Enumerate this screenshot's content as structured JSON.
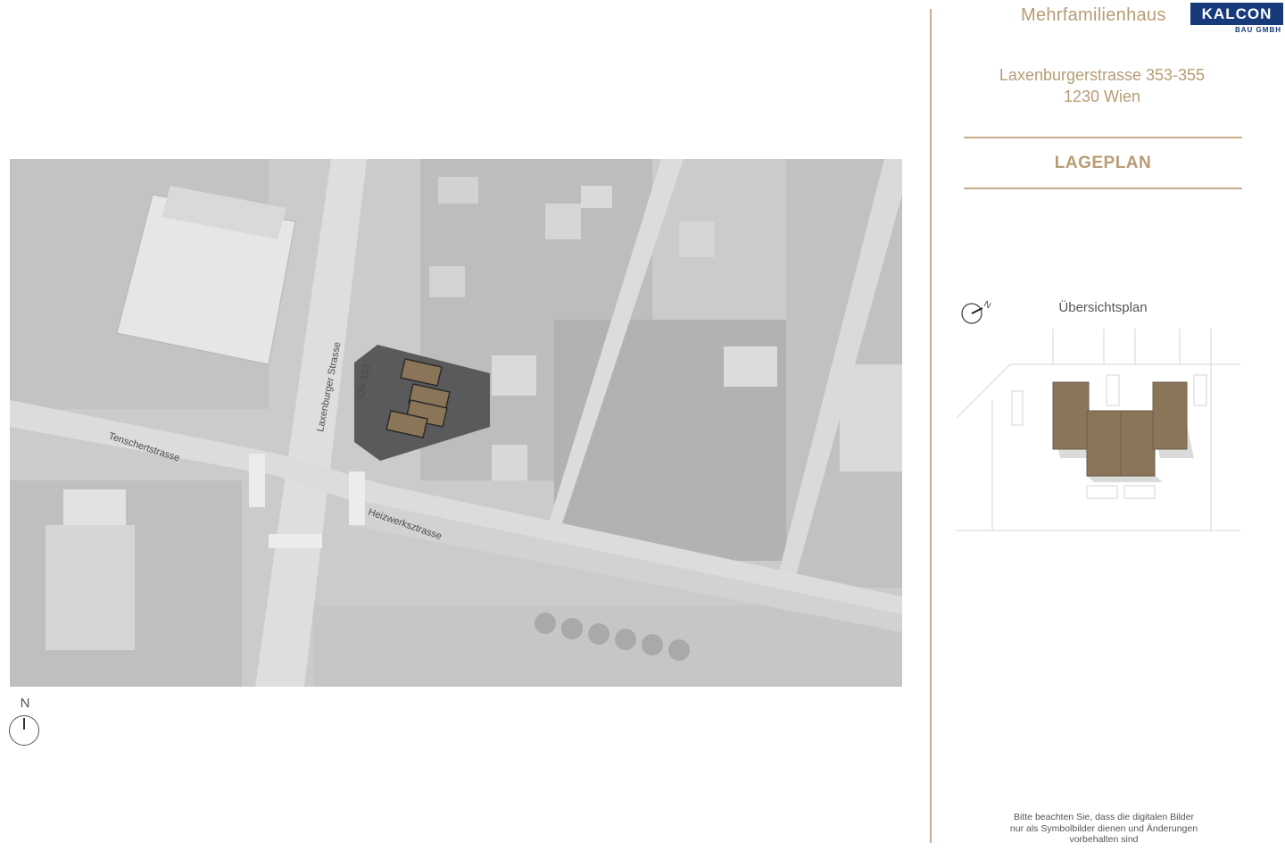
{
  "header": {
    "title": "Mehrfamilienhaus",
    "logo_main": "KALCON",
    "logo_sub": "BAU GMBH"
  },
  "address": {
    "street": "Laxenburgerstrasse 353-355",
    "city": "1230 Wien"
  },
  "section_title": "LAGEPLAN",
  "overview_label": "Übersichtsplan",
  "map": {
    "labels": {
      "street_main": "Laxenburger Strasse",
      "house_number": "ON 353",
      "street_left": "Tenschertstrasse",
      "street_right": "Heizwerksztrasse"
    },
    "north_label": "N"
  },
  "overview_compass_label": "N",
  "disclaimer": {
    "line1": "Bitte beachten Sie, dass die digitalen Bilder",
    "line2": "nur als Symbolbilder dienen und Änderungen",
    "line3": "vorbehalten sind"
  },
  "colors": {
    "accent": "#b89c74",
    "building": "#8a7559",
    "logo": "#173a7a"
  }
}
